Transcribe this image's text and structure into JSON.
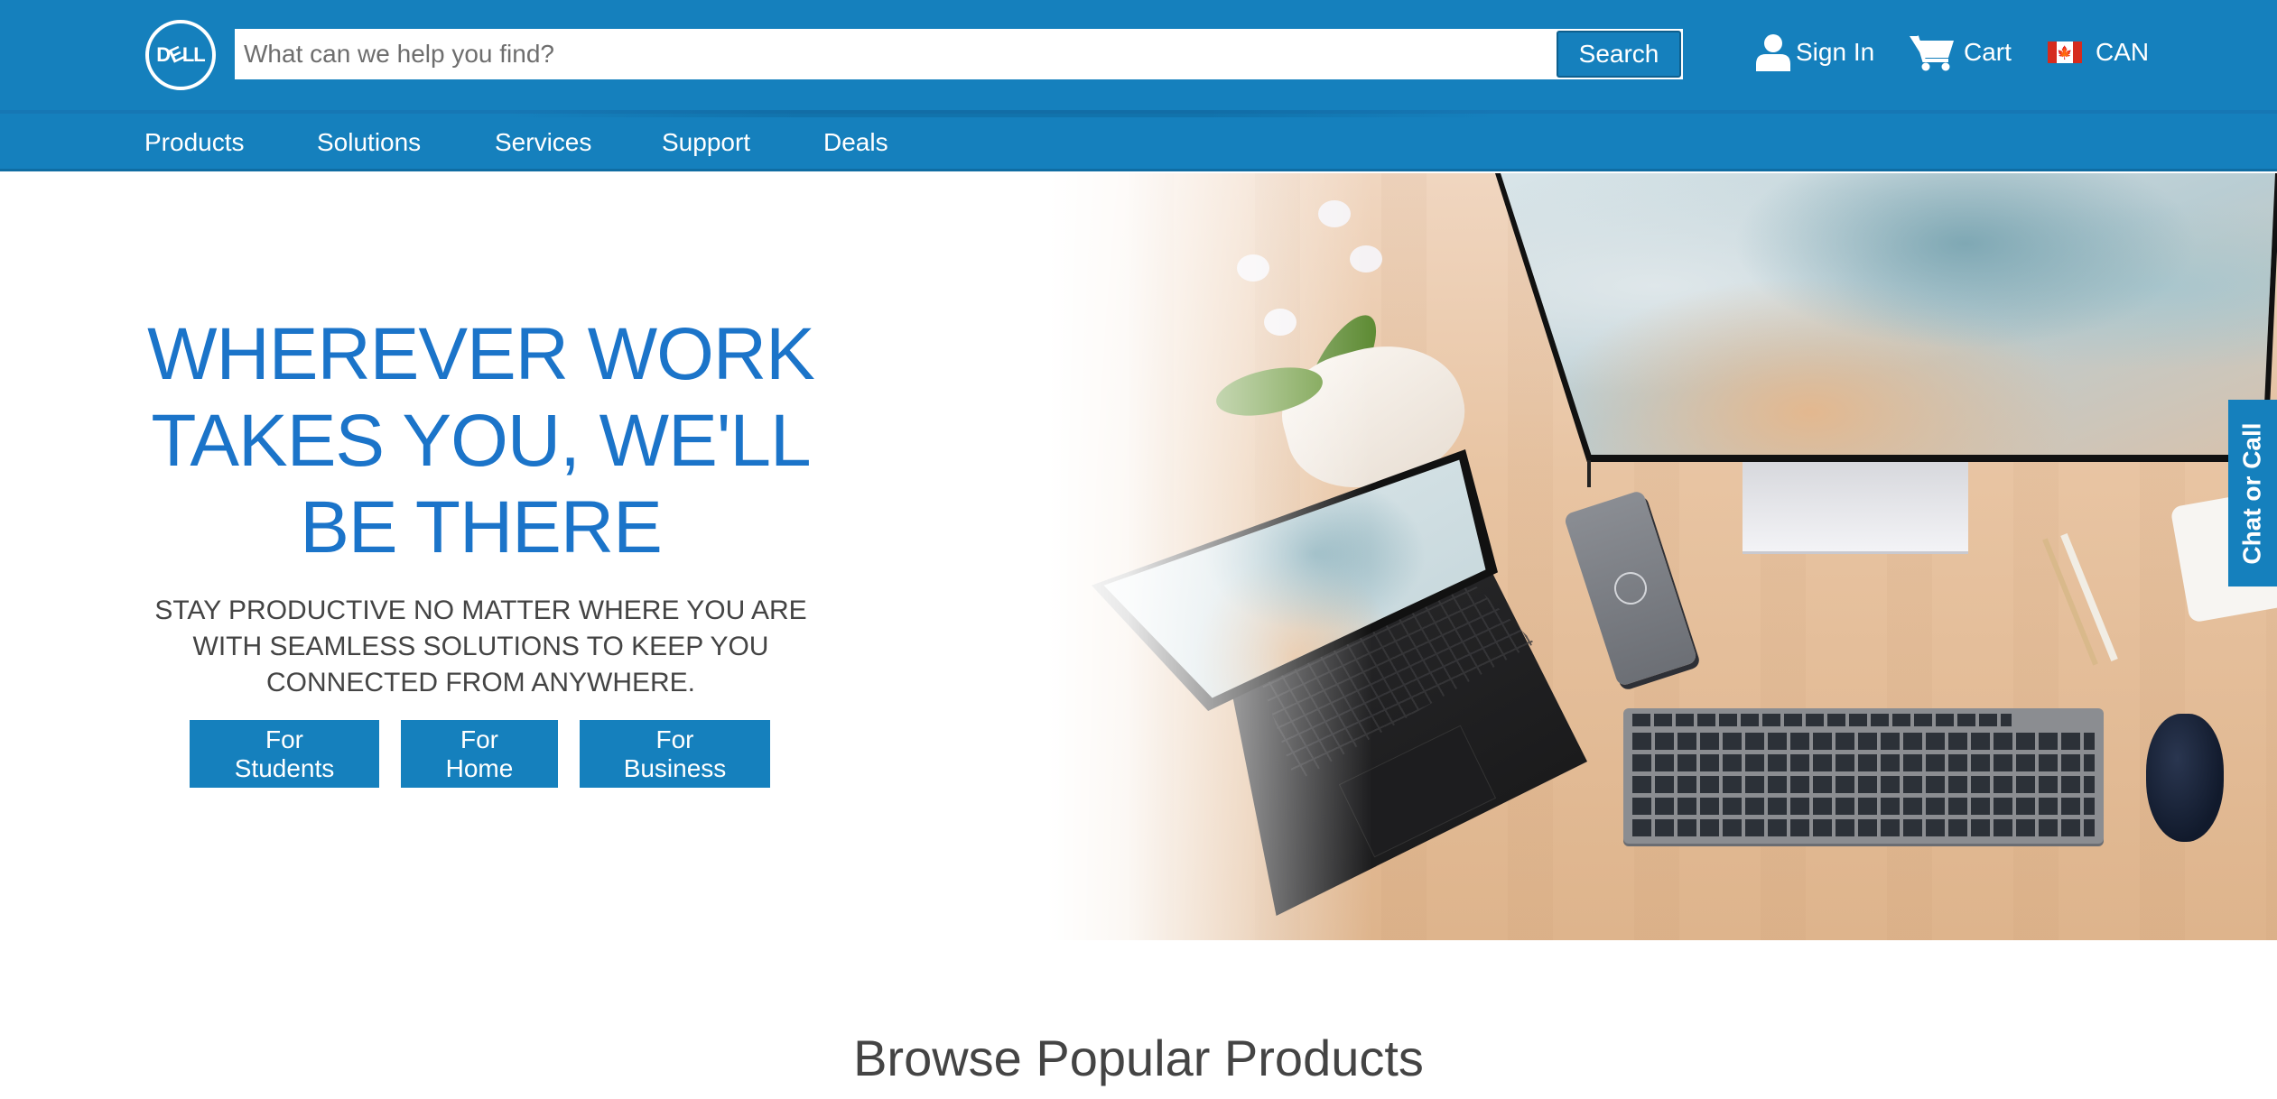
{
  "header": {
    "logo_text_left": "D",
    "logo_text_tilt": "E",
    "logo_text_right": "LL",
    "search": {
      "placeholder": "What can we help you find?",
      "value": "",
      "button_label": "Search"
    },
    "utilities": {
      "sign_in": {
        "label": "Sign In",
        "icon": "person-icon"
      },
      "cart": {
        "label": "Cart",
        "icon": "cart-icon"
      },
      "country": {
        "label": "CAN",
        "icon": "canada-flag-icon",
        "flag_glyph": "🍁"
      }
    }
  },
  "nav": {
    "items": [
      {
        "label": "Products"
      },
      {
        "label": "Solutions"
      },
      {
        "label": "Services"
      },
      {
        "label": "Support"
      },
      {
        "label": "Deals"
      }
    ]
  },
  "hero": {
    "headline_lines": [
      "WHEREVER WORK",
      "TAKES YOU, WE'LL",
      "BE THERE"
    ],
    "subtitle_lines": [
      "STAY PRODUCTIVE NO MATTER WHERE YOU ARE",
      "WITH SEAMLESS SOLUTIONS TO KEEP YOU",
      "CONNECTED FROM ANYWHERE."
    ],
    "buttons": [
      {
        "label": "For Students"
      },
      {
        "label": "For Home"
      },
      {
        "label": "For Business"
      }
    ],
    "image_description": "Desk setup with laptop, monitor, dock, keyboard, mouse and orchid"
  },
  "chat_tab": {
    "label": "Chat or Call"
  },
  "browse": {
    "title": "Browse Popular Products"
  },
  "colors": {
    "brand_blue": "#1580bd",
    "headline_blue": "#1b74c9",
    "body_text": "#444444",
    "flag_red": "#d52b1e"
  }
}
